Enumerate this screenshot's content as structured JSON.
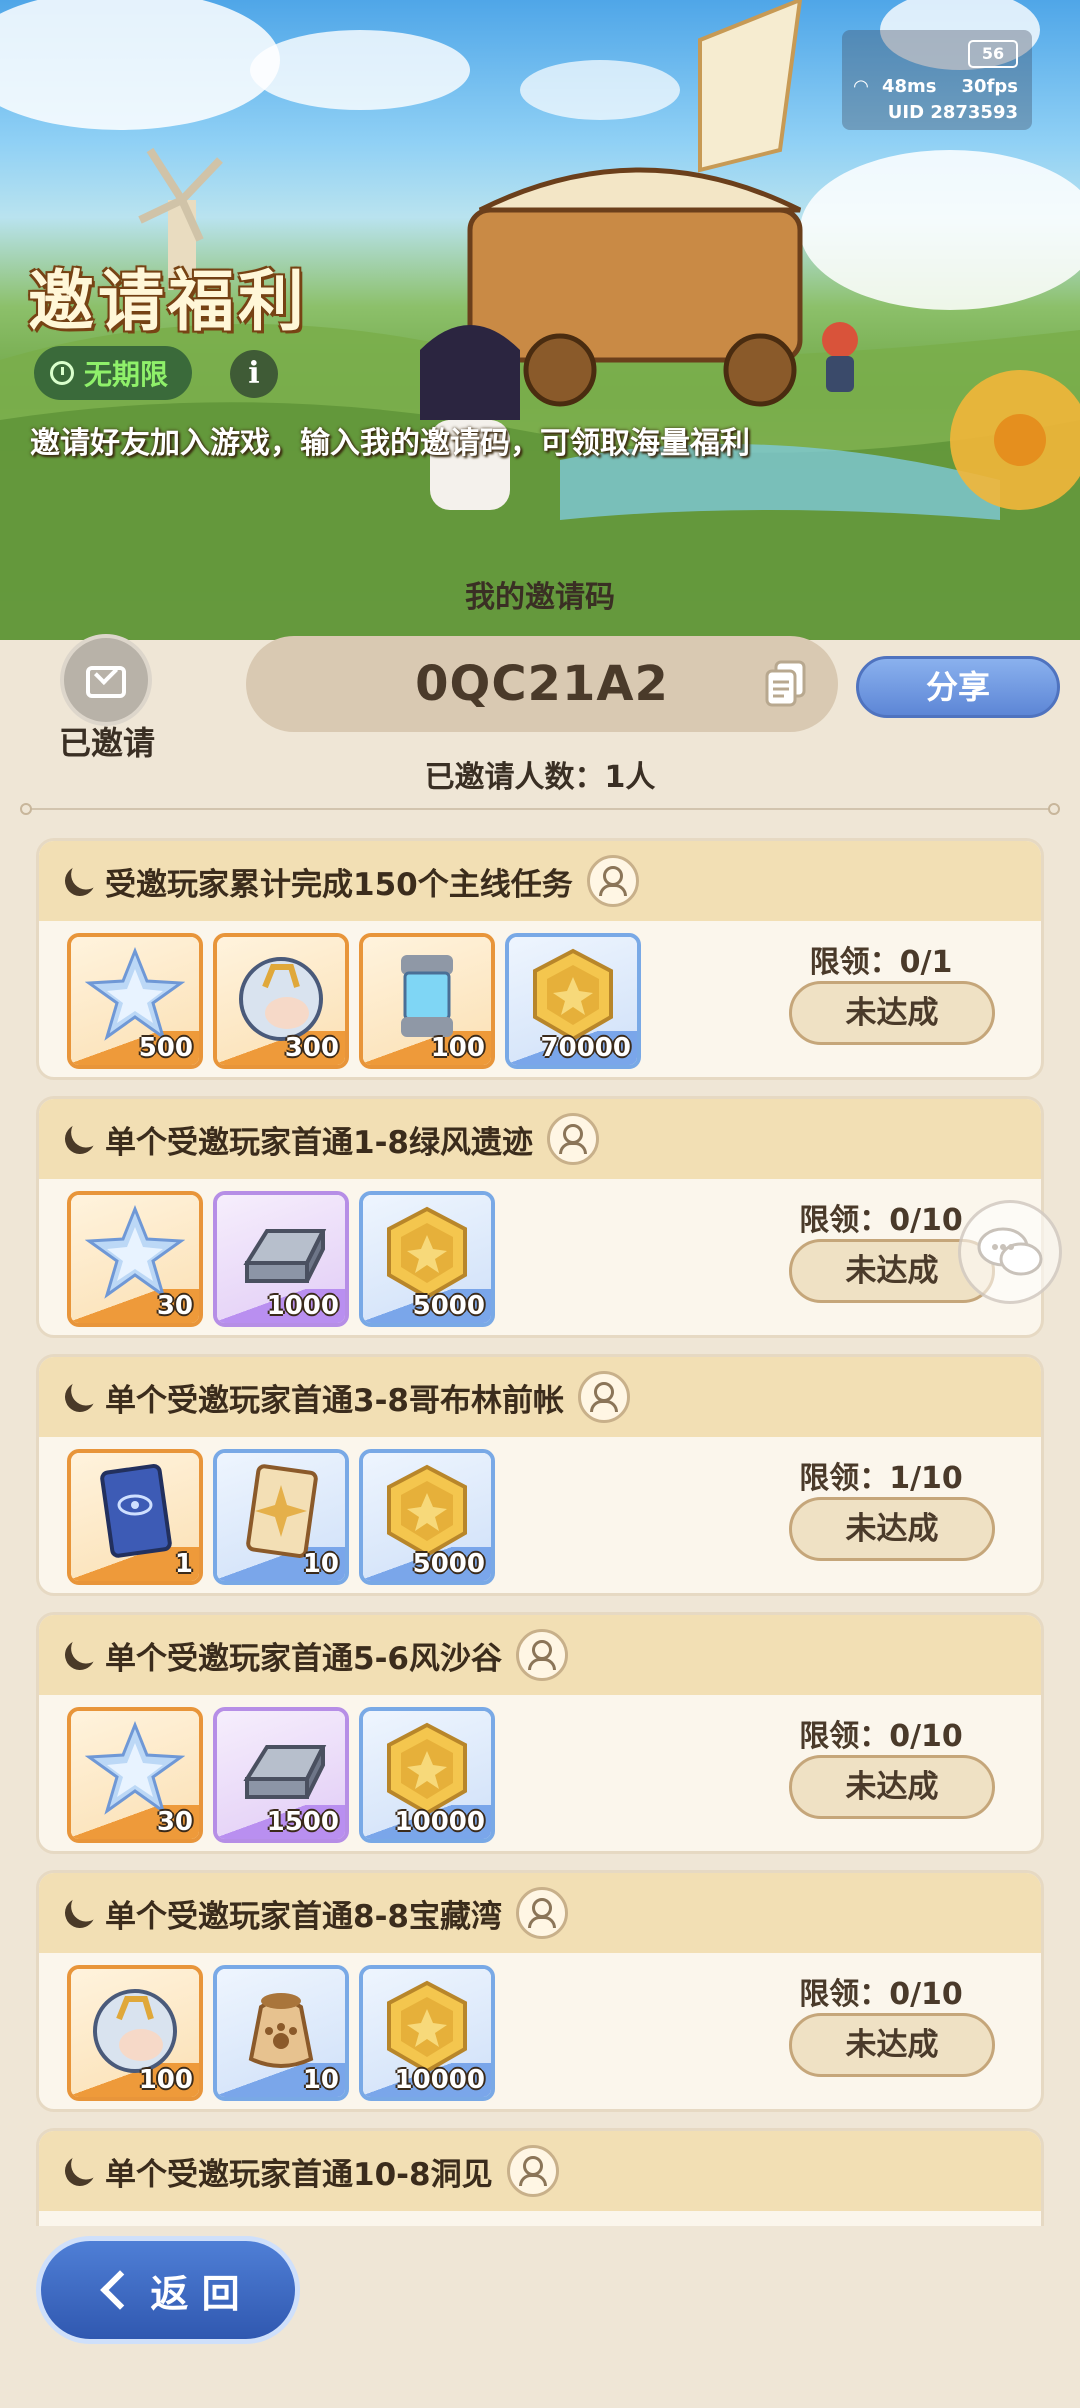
{
  "status": {
    "battery": "56",
    "ping": "48ms",
    "fps": "30fps",
    "uid": "UID 2873593"
  },
  "hero": {
    "title": "邀请福利",
    "period": "无期限",
    "info": "i",
    "description": "邀请好友加入游戏，输入我的邀请码，可领取海量福利"
  },
  "invite": {
    "code_title": "我的邀请码",
    "invited_label": "已邀请",
    "code": "0QC21A2",
    "share_label": "分享",
    "count_text": "已邀请人数：1人"
  },
  "tasks": [
    {
      "title": "受邀玩家累计完成150个主线任务",
      "limit": "限领：0/1",
      "status": "未达成",
      "rewards": [
        {
          "icon": "crystal-star-icon",
          "qty": "500"
        },
        {
          "icon": "rainbow-egg-icon",
          "qty": "300"
        },
        {
          "icon": "energy-capsule-icon",
          "qty": "100"
        },
        {
          "icon": "gold-coin-icon",
          "qty": "70000"
        }
      ]
    },
    {
      "title": "单个受邀玩家首通1-8绿风遗迹",
      "limit": "限领：0/10",
      "status": "未达成",
      "rewards": [
        {
          "icon": "crystal-star-icon",
          "qty": "30"
        },
        {
          "icon": "silver-ingot-icon",
          "qty": "1000"
        },
        {
          "icon": "gold-coin-icon",
          "qty": "5000"
        }
      ]
    },
    {
      "title": "单个受邀玩家首通3-8哥布林前帐",
      "limit": "限领：1/10",
      "status": "未达成",
      "rewards": [
        {
          "icon": "eye-card-icon",
          "qty": "1"
        },
        {
          "icon": "star-card-icon",
          "qty": "10"
        },
        {
          "icon": "gold-coin-icon",
          "qty": "5000"
        }
      ]
    },
    {
      "title": "单个受邀玩家首通5-6风沙谷",
      "limit": "限领：0/10",
      "status": "未达成",
      "rewards": [
        {
          "icon": "crystal-star-icon",
          "qty": "30"
        },
        {
          "icon": "silver-ingot-icon",
          "qty": "1500"
        },
        {
          "icon": "gold-coin-icon",
          "qty": "10000"
        }
      ]
    },
    {
      "title": "单个受邀玩家首通8-8宝藏湾",
      "limit": "限领：0/10",
      "status": "未达成",
      "rewards": [
        {
          "icon": "rainbow-egg-icon",
          "qty": "100"
        },
        {
          "icon": "paw-food-bag-icon",
          "qty": "10"
        },
        {
          "icon": "gold-coin-icon",
          "qty": "10000"
        }
      ]
    },
    {
      "title": "单个受邀玩家首通10-8洞见",
      "limit": "",
      "status": "",
      "rewards": []
    }
  ],
  "back_label": "返 回",
  "colors": {
    "accent_blue": "#5d86d6",
    "header_tan": "#f2dfb4",
    "background": "#efe6d6"
  }
}
